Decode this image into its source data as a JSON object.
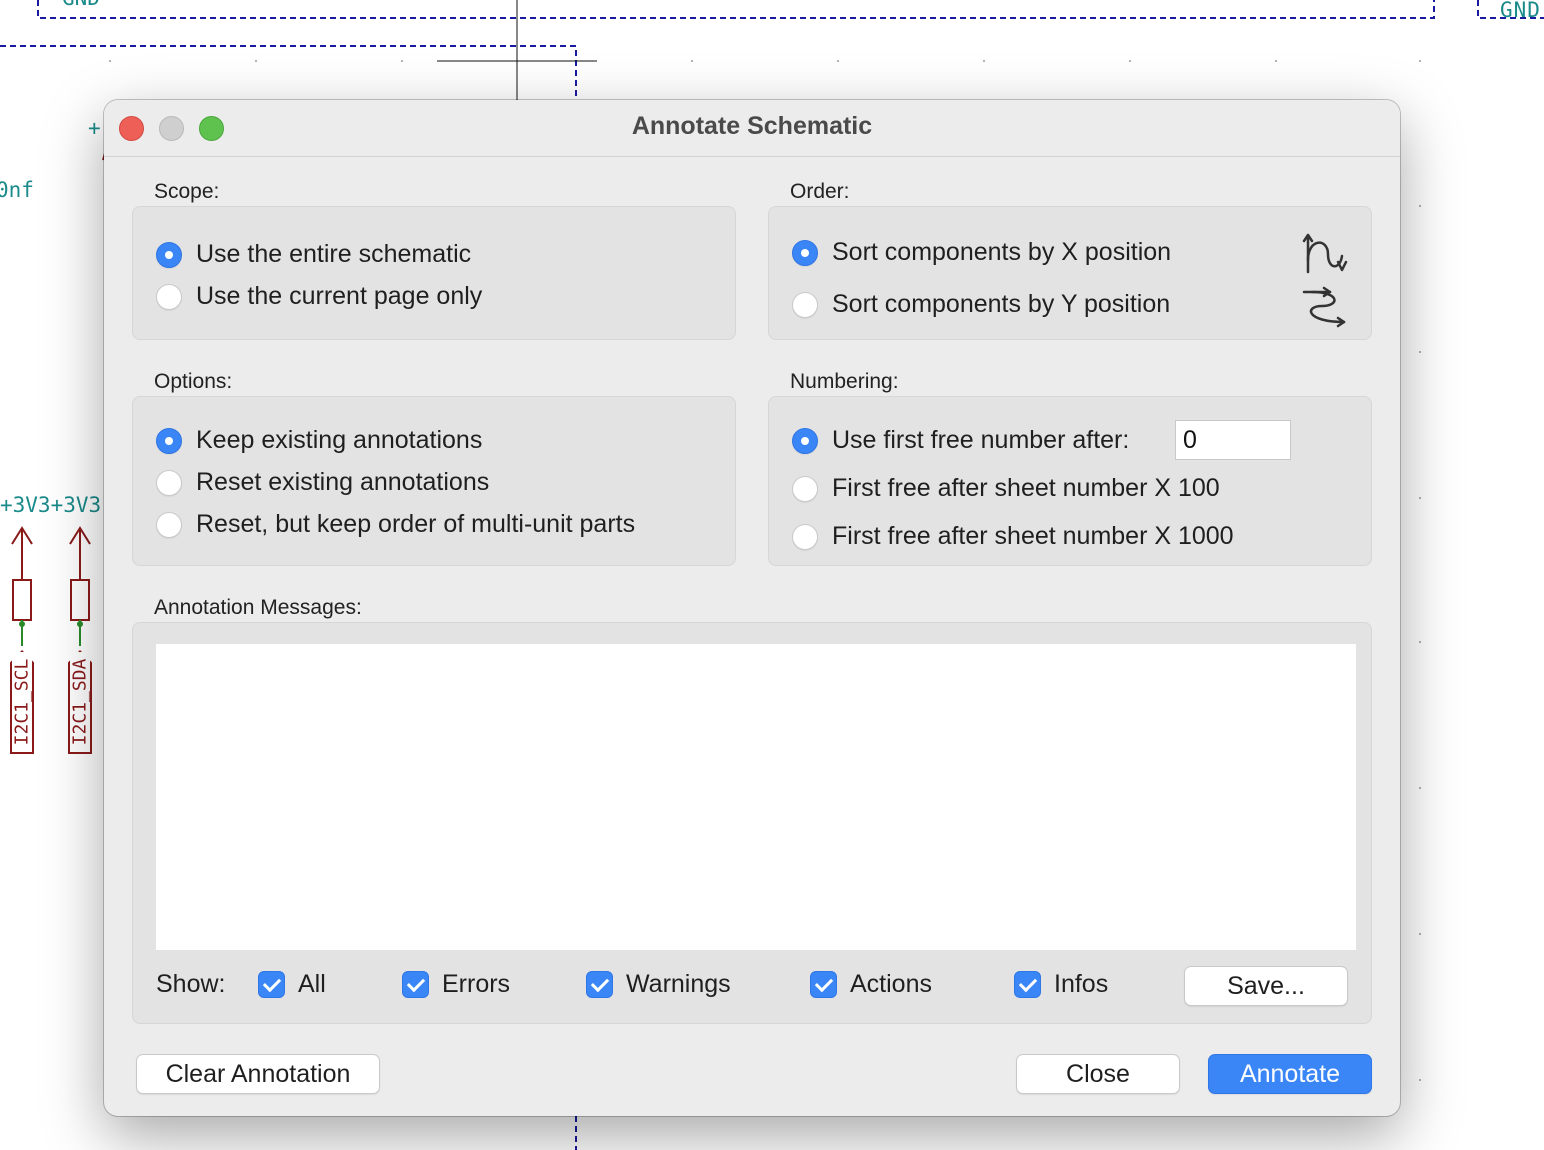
{
  "background": {
    "gnd_top": "GND",
    "gnd_right": "GND",
    "plus_label": "+",
    "cap_value": "0nf",
    "rail_labels": "+3V3+3V3",
    "net_scl": "I2C1_SCL",
    "net_sda": "I2C1_SDA"
  },
  "dialog": {
    "title": "Annotate Schematic",
    "scope": {
      "label": "Scope:",
      "options": [
        "Use the entire schematic",
        "Use the current page only"
      ],
      "selected": 0
    },
    "order": {
      "label": "Order:",
      "options": [
        "Sort components by X position",
        "Sort components by Y position"
      ],
      "selected": 0,
      "icons": [
        "sort-by-x-icon",
        "sort-by-y-icon"
      ]
    },
    "options": {
      "label": "Options:",
      "options": [
        "Keep existing annotations",
        "Reset existing annotations",
        "Reset, but keep order of multi-unit parts"
      ],
      "selected": 0
    },
    "numbering": {
      "label": "Numbering:",
      "options": [
        "Use first free number after:",
        "First free after sheet number X 100",
        "First free after sheet number X 1000"
      ],
      "selected": 0,
      "start_value": "0"
    },
    "messages": {
      "label": "Annotation Messages:",
      "show_label": "Show:",
      "filters": [
        {
          "label": "All",
          "checked": true
        },
        {
          "label": "Errors",
          "checked": true
        },
        {
          "label": "Warnings",
          "checked": true
        },
        {
          "label": "Actions",
          "checked": true
        },
        {
          "label": "Infos",
          "checked": true
        }
      ],
      "save_label": "Save..."
    },
    "buttons": {
      "clear": "Clear Annotation",
      "close": "Close",
      "annotate": "Annotate"
    }
  },
  "colors": {
    "accent": "#3b86f7",
    "schematic_net": "#1a8a8a",
    "schematic_label": "#8a1a1a",
    "sheet_border": "#1a1aa0"
  }
}
